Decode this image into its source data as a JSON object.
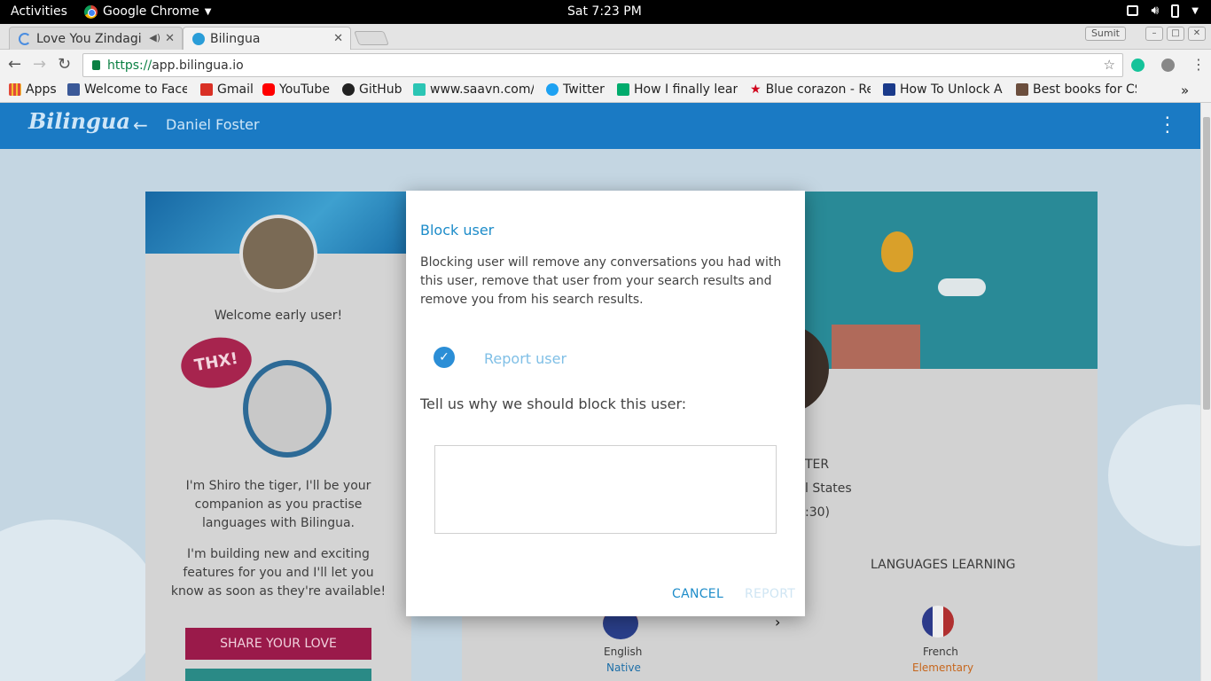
{
  "gnome": {
    "activities": "Activities",
    "app_name": "Google Chrome",
    "clock": "Sat  7:23 PM"
  },
  "tabs": [
    {
      "title": "Love You Zindagi",
      "active": false
    },
    {
      "title": "Bilingua",
      "active": true
    }
  ],
  "profile": "Sumit",
  "address": {
    "scheme": "https://",
    "host": "app.bilingua.io"
  },
  "bookmarks": [
    {
      "label": "Apps",
      "color": "#e34a3a"
    },
    {
      "label": "Welcome to Face",
      "color": "#3b5998"
    },
    {
      "label": "Gmail",
      "color": "#d93025"
    },
    {
      "label": "YouTube",
      "color": "#ff0000"
    },
    {
      "label": "GitHub",
      "color": "#222222"
    },
    {
      "label": "www.saavn.com/",
      "color": "#2bc5b4"
    },
    {
      "label": "Twitter",
      "color": "#1da1f2"
    },
    {
      "label": "How I finally lear",
      "color": "#00ab6c"
    },
    {
      "label": "Blue corazon - Re",
      "color": "#d0021b"
    },
    {
      "label": "How To Unlock A",
      "color": "#1a3a8a"
    },
    {
      "label": "Best books for CS",
      "color": "#6b4e3d"
    }
  ],
  "app": {
    "logo": "Bilingua",
    "profile_name": "Daniel Foster"
  },
  "left_card": {
    "welcome": "Welcome early user!",
    "para1": "I'm Shiro the tiger, I'll be your companion as you practise languages with Bilingua.",
    "para2": "I'm building new and exciting features for you and I'll let you know as soon as they're available!",
    "share_button": "SHARE YOUR LOVE",
    "thx": "THX!"
  },
  "right_card": {
    "partial_name": "TER",
    "partial_country": "l States",
    "partial_time": ":30)",
    "languages_learning": "LANGUAGES LEARNING",
    "native_language": "English",
    "native_level": "Native",
    "learning_language": "French",
    "learning_level": "Elementary"
  },
  "dialog": {
    "title": "Block user",
    "description": "Blocking user will remove any conversations you had with this user, remove that user from your search results and remove you from his search results.",
    "report_label": "Report user",
    "report_checked": true,
    "reason_label": "Tell us why we should block this user:",
    "reason_value": "",
    "cancel": "CANCEL",
    "report": "REPORT"
  }
}
